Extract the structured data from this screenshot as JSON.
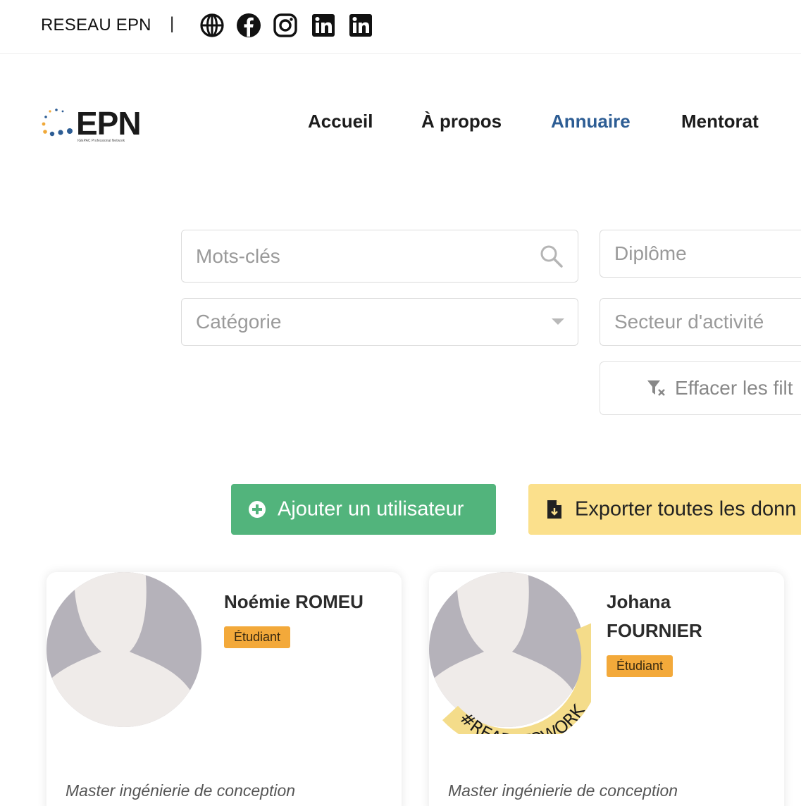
{
  "topbar": {
    "network_label": "RESEAU EPN",
    "separator": "|",
    "social_icons": [
      "globe-icon",
      "facebook-icon",
      "instagram-icon",
      "linkedin-icon",
      "linkedin-icon"
    ]
  },
  "logo": {
    "word": "EPN",
    "tagline": "IGEPAC Professional Network"
  },
  "nav": {
    "items": [
      "Accueil",
      "À propos",
      "Annuaire",
      "Mentorat"
    ],
    "active": "Annuaire",
    "active_color": "#2d5d94"
  },
  "filters": {
    "keywords_placeholder": "Mots-clés",
    "diploma_placeholder": "Diplôme",
    "category_placeholder": "Catégorie",
    "sector_placeholder": "Secteur d'activité",
    "clear_label": "Effacer les filt"
  },
  "actions": {
    "add_user_label": "Ajouter un utilisateur",
    "add_user_color": "#52b47c",
    "export_label": "Exporter toutes les donn",
    "export_color": "#fbe08c"
  },
  "cards": [
    {
      "name": "Noémie ROMEU",
      "badge": "Étudiant",
      "degree": "Master ingénierie de conception"
    },
    {
      "name_line1": "Johana",
      "name_line2": "FOURNIER",
      "badge": "Étudiant",
      "degree": "Master ingénierie de conception",
      "ribbon": "#READYTOWORK"
    }
  ],
  "badge_color": "#f3a93a"
}
